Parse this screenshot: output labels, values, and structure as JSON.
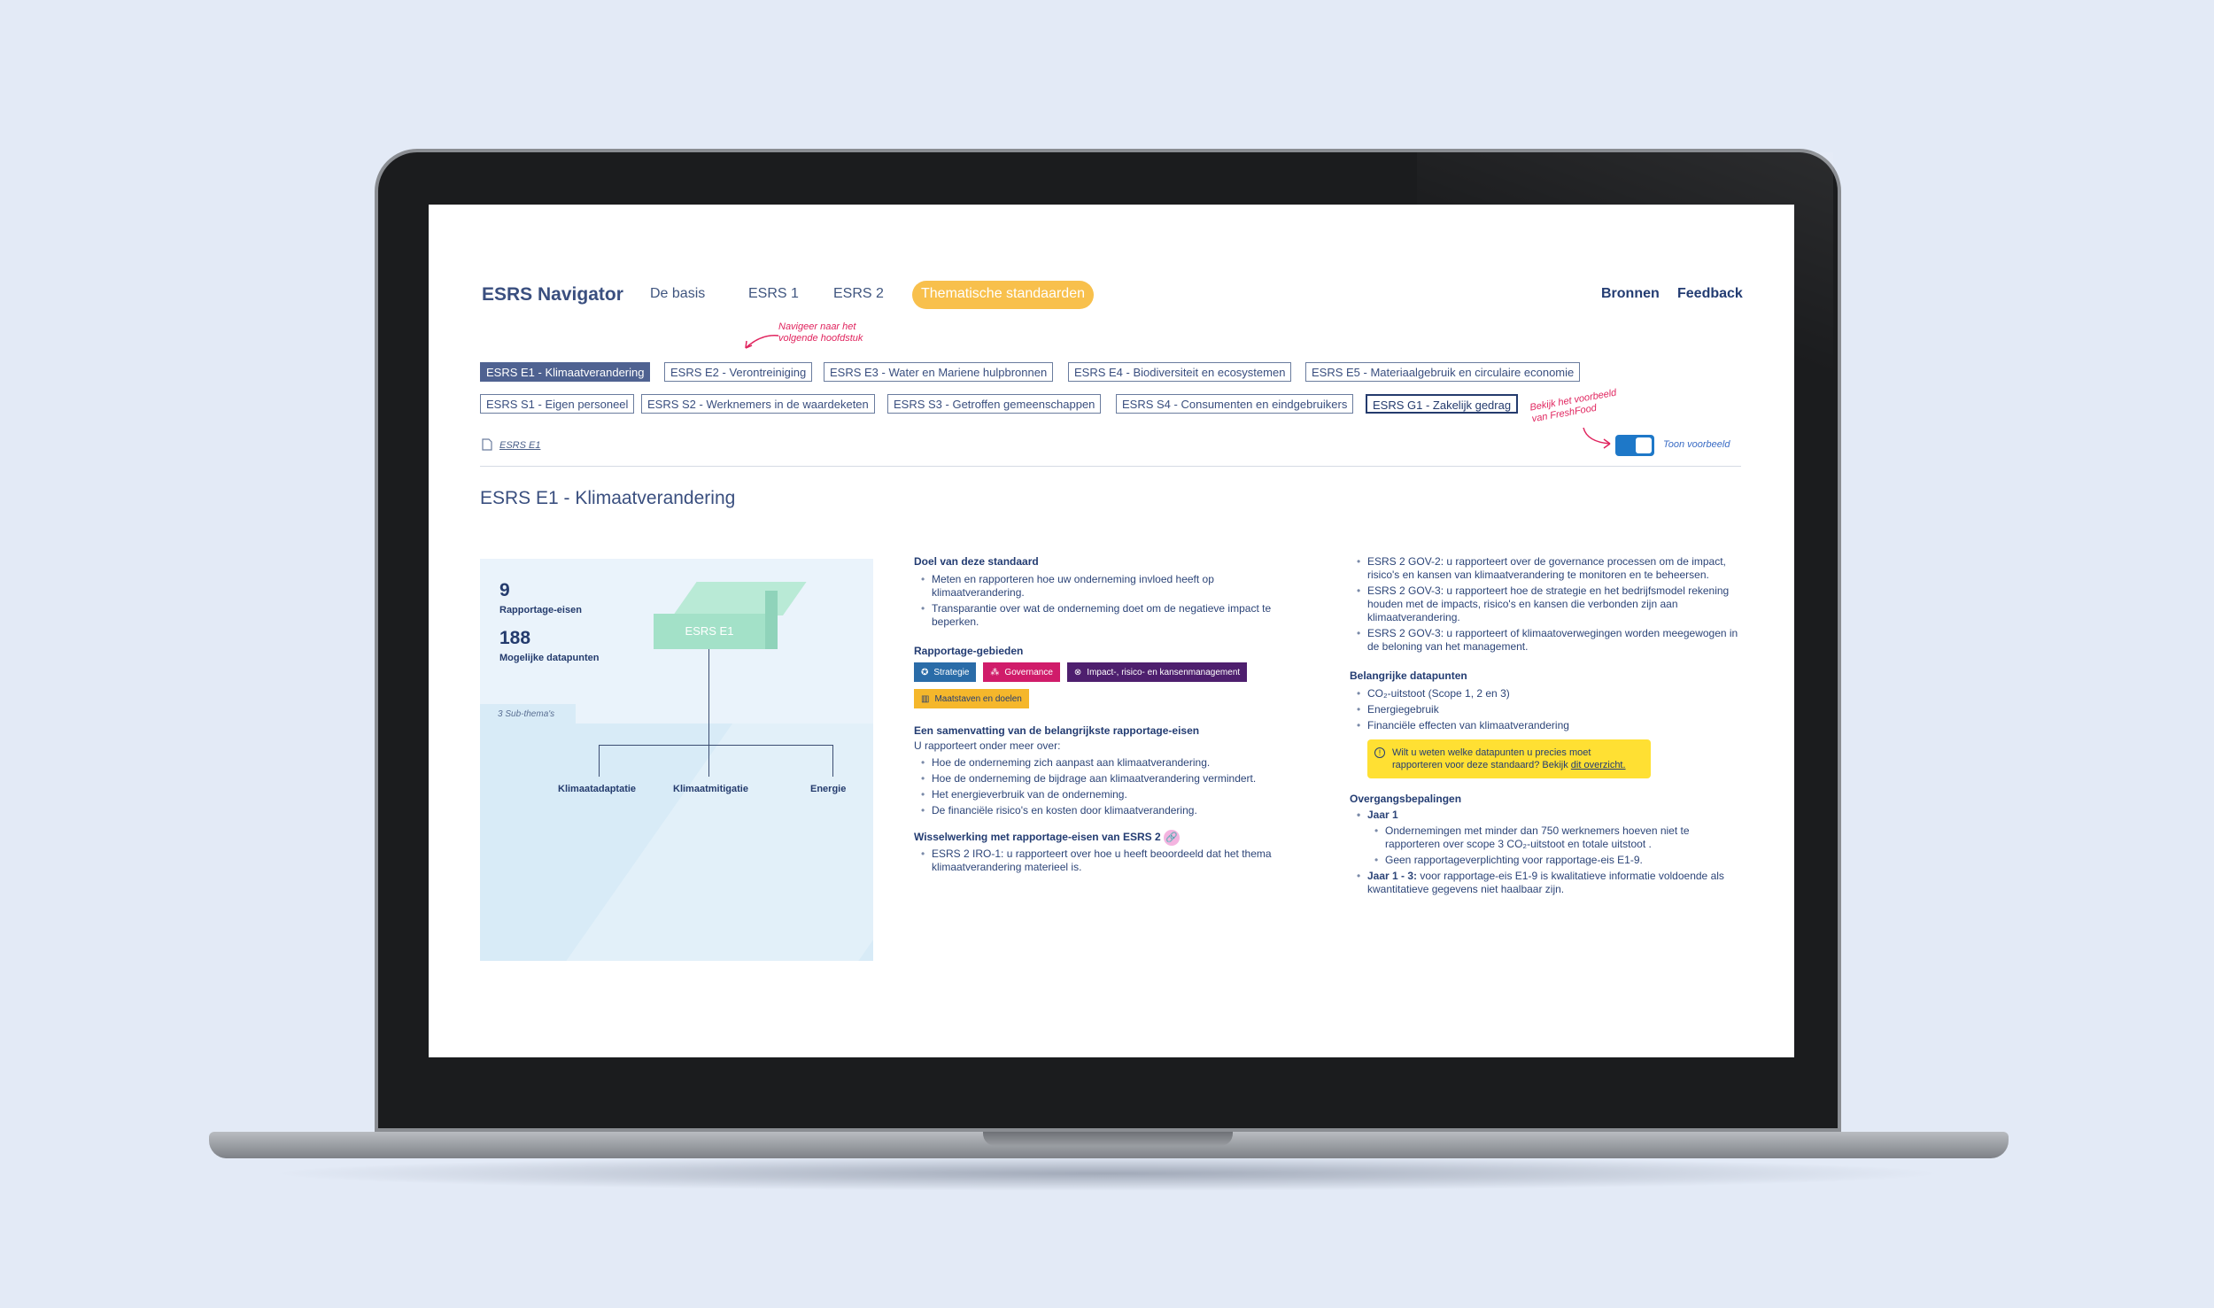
{
  "header": {
    "brand": "ESRS Navigator",
    "nav": [
      "De basis",
      "ESRS 1",
      "ESRS 2"
    ],
    "nav_active": "Thematische standaarden",
    "bronnen": "Bronnen",
    "feedback": "Feedback"
  },
  "annotations": {
    "nav_hint": "Navigeer naar het volgende hoofdstuk",
    "example_hint": "Bekijk het voorbeeld van FreshFood"
  },
  "standards_row1": [
    "ESRS E1 - Klimaatverandering",
    "ESRS E2 - Verontreiniging",
    "ESRS E3 - Water en Mariene hulpbronnen",
    "ESRS E4 - Biodiversiteit en ecosystemen",
    "ESRS E5 - Materiaalgebruik en circulaire economie"
  ],
  "standards_row2": [
    "ESRS S1 - Eigen personeel",
    "ESRS S2 - Werknemers in de waardeketen",
    "ESRS S3 - Getroffen gemeenschappen",
    "ESRS S4 - Consumenten en eindgebruikers",
    "ESRS G1 - Zakelijk gedrag"
  ],
  "breadcrumb": "ESRS E1",
  "toggle": {
    "label": "Toon voorbeeld",
    "on": true
  },
  "page_title": "ESRS E1 - Klimaatverandering",
  "visual": {
    "req_count": "9",
    "req_label": "Rapportage-eisen",
    "dp_count": "188",
    "dp_label": "Mogelijke datapunten",
    "subthemes_label": "3 Sub-thema's",
    "root": "ESRS E1",
    "children": [
      "Klimaatadaptatie",
      "Klimaatmitigatie",
      "Energie"
    ]
  },
  "col1": {
    "goal_title": "Doel van deze standaard",
    "goal_items": [
      "Meten en rapporteren hoe uw onderneming invloed heeft op klimaatverandering.",
      "Transparantie over wat de onderneming doet om de negatieve impact te beperken."
    ],
    "areas_title": "Rapportage-gebieden",
    "areas": [
      {
        "label": "Strategie",
        "color": "#2a6ca8",
        "icon": "✪"
      },
      {
        "label": "Governance",
        "color": "#d01c6a",
        "icon": "⁂"
      },
      {
        "label": "Impact-, risico- en kansenmanagement",
        "color": "#4e1f6e",
        "icon": "⊗"
      },
      {
        "label": "Maatstaven en doelen",
        "color": "#f5b72b",
        "icon": "▥"
      }
    ],
    "summary_title": "Een samenvatting van de belangrijkste rapportage-eisen",
    "summary_intro": "U rapporteert onder meer over:",
    "summary_items": [
      "Hoe de onderneming zich aanpast aan klimaatverandering.",
      "Hoe de onderneming de bijdrage aan klimaatverandering vermindert.",
      "Het energieverbruik van de onderneming.",
      "De financiële risico's en kosten door klimaatverandering."
    ],
    "interaction_title": "Wisselwerking met rapportage-eisen van ESRS 2",
    "interaction_items": [
      "ESRS 2 IRO-1: u rapporteert over hoe u heeft beoordeeld dat het thema klimaatverandering materieel is."
    ]
  },
  "col2": {
    "gov_items": [
      "ESRS 2 GOV-2: u rapporteert over de governance processen om de impact, risico's en kansen van klimaatverandering te monitoren en te beheersen.",
      "ESRS 2 GOV-3: u rapporteert hoe de strategie en het bedrijfsmodel rekening houden met de impacts, risico's en kansen die verbonden zijn aan klimaatverandering.",
      "ESRS 2 GOV-3: u rapporteert of klimaatoverwegingen worden meegewogen in de beloning van het management."
    ],
    "datapoints_title": "Belangrijke datapunten",
    "datapoints": [
      "CO₂-uitstoot (Scope 1, 2 en 3)",
      "Energiegebruik",
      "Financiële effecten van klimaatverandering"
    ],
    "info_text": "Wilt u weten welke datapunten u precies moet rapporteren voor deze standaard?  Bekijk",
    "info_link": "dit overzicht.",
    "transition_title": "Overgangsbepalingen",
    "year1_label": "Jaar 1",
    "year1_items": [
      "Ondernemingen met minder dan 750 werknemers hoeven niet te rapporteren over scope 3 CO₂-uitstoot en totale uitstoot .",
      "Geen rapportageverplichting voor rapportage-eis E1-9."
    ],
    "year13_label": "Jaar 1 - 3:",
    "year13_text": "voor rapportage-eis E1-9 is kwalitatieve informatie voldoende als kwantitatieve gegevens niet haalbaar zijn."
  }
}
